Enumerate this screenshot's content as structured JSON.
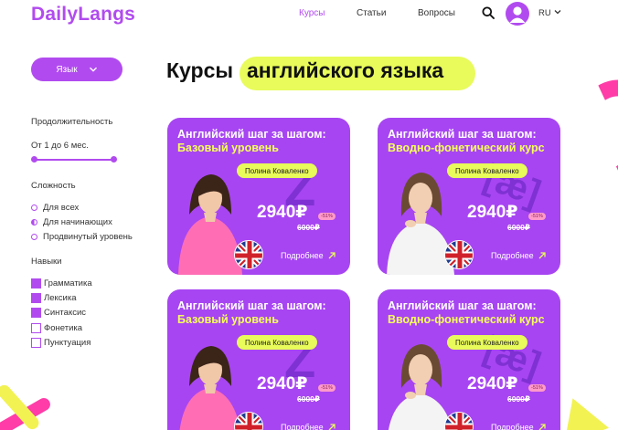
{
  "header": {
    "logo": "DailyLangs",
    "nav": {
      "courses": "Курсы",
      "articles": "Статьи",
      "questions": "Вопросы"
    },
    "language": "RU",
    "icons": {
      "search": "search-icon",
      "avatar": "user-icon",
      "chevron": "chevron-down-icon"
    }
  },
  "sidebar": {
    "language_button": "Язык",
    "duration": {
      "heading": "Продолжительность",
      "value": "От 1 до 6 мес."
    },
    "difficulty": {
      "heading": "Сложность",
      "options": [
        "Для всех",
        "Для начинающих",
        "Продвинутый уровень"
      ],
      "selected": "Для начинающих"
    },
    "skills": {
      "heading": "Навыки",
      "options": [
        "Грамматика",
        "Лексика",
        "Синтаксис",
        "Фонетика",
        "Пунктуация"
      ],
      "checked": [
        "Грамматика",
        "Лексика",
        "Синтаксис"
      ]
    }
  },
  "main": {
    "title_plain": "Курсы",
    "title_highlight": "английского языка",
    "cards": [
      {
        "title": "Английский шаг за шагом:",
        "subtitle": "Базовый уровень",
        "author": "Полина Коваленко",
        "price": "2940₽",
        "old_price": "6000₽",
        "discount": "-51%",
        "more": "Подробнее",
        "glyph": "Z"
      },
      {
        "title": "Английский шаг за шагом:",
        "subtitle": "Вводно-фонетический курс",
        "author": "Полина Коваленко",
        "price": "2940₽",
        "old_price": "6000₽",
        "discount": "-51%",
        "more": "Подробнее",
        "glyph": "[æ]"
      },
      {
        "title": "Английский шаг за шагом:",
        "subtitle": "Базовый уровень",
        "author": "Полина Коваленко",
        "price": "2940₽",
        "old_price": "6000₽",
        "discount": "-51%",
        "more": "Подробнее",
        "glyph": "Z"
      },
      {
        "title": "Английский шаг за шагом:",
        "subtitle": "Вводно-фонетический курс",
        "author": "Полина Коваленко",
        "price": "2940₽",
        "old_price": "6000₽",
        "discount": "-51%",
        "more": "Подробнее",
        "glyph": "[æ]"
      }
    ]
  },
  "colors": {
    "brand": "#b14bef",
    "card": "#a745f2",
    "highlight": "#e8fb5a",
    "accent_pink": "#ff3ca8",
    "accent_yellow": "#f2f252"
  }
}
